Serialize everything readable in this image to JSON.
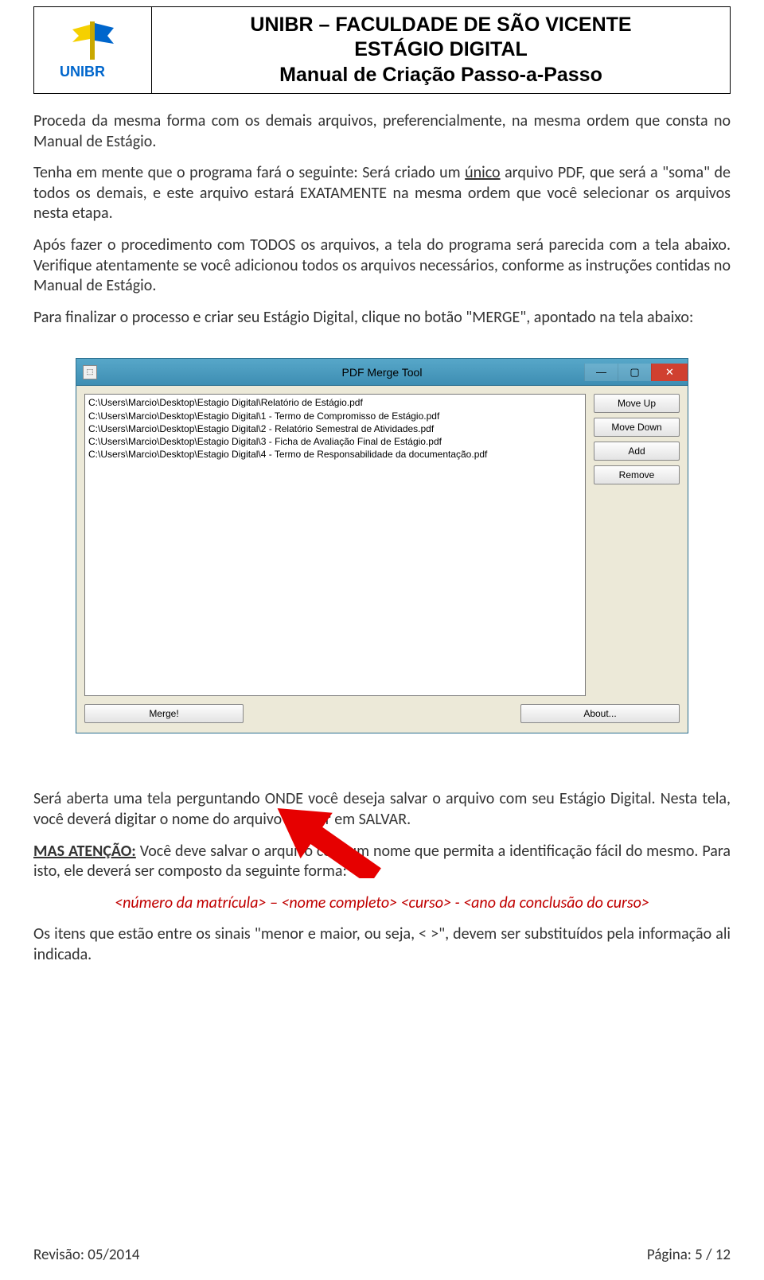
{
  "header": {
    "logo_text": "UNIBR",
    "title_line1": "UNIBR – FACULDADE DE SÃO VICENTE",
    "title_line2": "ESTÁGIO DIGITAL",
    "title_line3": "Manual de Criação Passo-a-Passo"
  },
  "paragraphs": {
    "p1": "Proceda da mesma forma com os demais arquivos, preferencialmente, na mesma ordem que consta no Manual de Estágio.",
    "p2a": "Tenha em mente que o programa fará o seguinte: Será criado um ",
    "p2_under": "único",
    "p2b": " arquivo PDF, que será a \"soma\" de todos os demais, e este arquivo estará EXATAMENTE na mesma ordem que você selecionar os arquivos nesta etapa.",
    "p3": "Após fazer o procedimento com TODOS os arquivos, a tela do programa será parecida com a tela abaixo. Verifique atentamente se você adicionou todos os arquivos necessários, conforme as instruções contidas no Manual de Estágio.",
    "p4": "Para finalizar o processo e criar seu Estágio Digital, clique no botão \"MERGE\", apontado na tela abaixo:",
    "p5": "Será aberta uma tela perguntando ONDE você deseja salvar o arquivo com seu Estágio Digital. Nesta tela, você deverá digitar o nome do arquivo e clicar em SALVAR.",
    "p6a": "MAS ATENÇÃO:",
    "p6b": " Você deve salvar o arquivo com um nome que permita a identificação fácil do mesmo. Para isto, ele deverá ser composto da seguinte forma:",
    "p7": "<número da matrícula> – <nome completo> <curso> - <ano da conclusão do curso>",
    "p8": "Os itens que estão entre os sinais \"menor e maior, ou seja, < >\", devem ser substituídos pela informação ali indicada."
  },
  "app": {
    "title": "PDF Merge Tool",
    "files": [
      "C:\\Users\\Marcio\\Desktop\\Estagio Digital\\Relatório de Estágio.pdf",
      "C:\\Users\\Marcio\\Desktop\\Estagio Digital\\1 - Termo de Compromisso de Estágio.pdf",
      "C:\\Users\\Marcio\\Desktop\\Estagio Digital\\2 - Relatório Semestral de Atividades.pdf",
      "C:\\Users\\Marcio\\Desktop\\Estagio Digital\\3 - Ficha de Avaliação Final de Estágio.pdf",
      "C:\\Users\\Marcio\\Desktop\\Estagio Digital\\4 - Termo de Responsabilidade da documentação.pdf"
    ],
    "buttons": {
      "move_up": "Move Up",
      "move_down": "Move Down",
      "add": "Add",
      "remove": "Remove",
      "merge": "Merge!",
      "about": "About..."
    }
  },
  "footer": {
    "revision": "Revisão: 05/2014",
    "page": "Página: 5 / 12"
  }
}
